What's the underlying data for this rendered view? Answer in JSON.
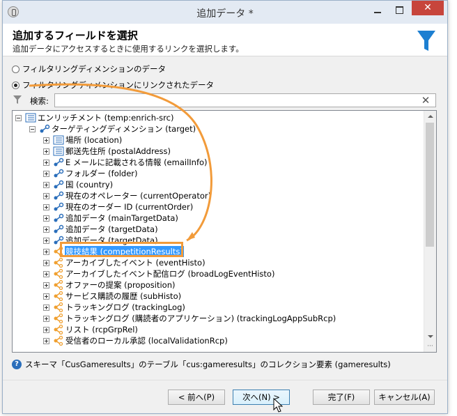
{
  "window": {
    "title": "追加データ *",
    "close_glyph": "✕",
    "app_icon": "app-icon"
  },
  "header": {
    "title": "追加するフィールドを選択",
    "subtitle": "追加データにアクセスするときに使用するリンクを選択します。",
    "icon": "funnel-icon",
    "accent": "#1d7fd1"
  },
  "options": {
    "radio1": {
      "label": "フィルタリングディメンションのデータ",
      "checked": false
    },
    "radio2": {
      "label": "フィルタリングディメンションにリンクされたデータ",
      "checked": true
    }
  },
  "search": {
    "label": "検索:",
    "value": "",
    "placeholder": "",
    "clear_glyph": "✕"
  },
  "tree": {
    "items": [
      {
        "label": "エンリッチメント (temp:enrich-src)",
        "level": 0,
        "expander": "minus",
        "icon": "table-icon"
      },
      {
        "label": "ターゲティングディメンション (target)",
        "level": 1,
        "expander": "minus",
        "icon": "link-icon"
      },
      {
        "label": "場所 (location)",
        "level": 2,
        "expander": "plus",
        "icon": "table-icon"
      },
      {
        "label": "郵送先住所 (postalAddress)",
        "level": 2,
        "expander": "plus",
        "icon": "table-icon"
      },
      {
        "label": "E メールに記載される情報 (emailInfo)",
        "level": 2,
        "expander": "plus",
        "icon": "link-icon"
      },
      {
        "label": "フォルダー (folder)",
        "level": 2,
        "expander": "plus",
        "icon": "link-icon"
      },
      {
        "label": "国 (country)",
        "level": 2,
        "expander": "plus",
        "icon": "link-icon"
      },
      {
        "label": "現在のオペレーター (currentOperator)",
        "level": 2,
        "expander": "plus",
        "icon": "link-icon"
      },
      {
        "label": "現在のオーダー ID (currentOrder)",
        "level": 2,
        "expander": "plus",
        "icon": "link-icon"
      },
      {
        "label": "追加データ (mainTargetData)",
        "level": 2,
        "expander": "plus",
        "icon": "link-icon"
      },
      {
        "label": "追加データ (targetData)",
        "level": 2,
        "expander": "plus",
        "icon": "link-icon"
      },
      {
        "label": "追加データ (targetData)",
        "level": 2,
        "expander": "plus",
        "icon": "link-icon"
      },
      {
        "label": "競技結果 (competitionResults)",
        "level": 2,
        "expander": "plus",
        "icon": "collection-icon",
        "selected": true
      },
      {
        "label": "アーカイブしたイベント (eventHisto)",
        "level": 2,
        "expander": "plus",
        "icon": "collection-icon"
      },
      {
        "label": "アーカイブしたイベント配信ログ (broadLogEventHisto)",
        "level": 2,
        "expander": "plus",
        "icon": "collection-icon"
      },
      {
        "label": "オファーの提案 (proposition)",
        "level": 2,
        "expander": "plus",
        "icon": "collection-icon"
      },
      {
        "label": "サービス購読の履歴 (subHisto)",
        "level": 2,
        "expander": "plus",
        "icon": "collection-icon"
      },
      {
        "label": "トラッキングログ (trackingLog)",
        "level": 2,
        "expander": "plus",
        "icon": "collection-icon"
      },
      {
        "label": "トラッキングログ (購読者のアプリケーション) (trackingLogAppSubRcp)",
        "level": 2,
        "expander": "plus",
        "icon": "collection-icon"
      },
      {
        "label": "リスト (rcpGrpRel)",
        "level": 2,
        "expander": "plus",
        "icon": "collection-icon"
      },
      {
        "label": "受信者のローカル承認 (localValidationRcp)",
        "level": 2,
        "expander": "plus",
        "icon": "collection-icon"
      }
    ],
    "scroll_grip": "···"
  },
  "info": {
    "icon": "help-icon",
    "glyph": "?",
    "text": "スキーマ「CusGameresults」のテーブル「cus:gameresults」のコレクション要素 (gameresults)"
  },
  "footer": {
    "prev_label": "< 前へ(P)",
    "next_label": "次へ(N) >",
    "finish_label": "完了(F)",
    "cancel_label": "キャンセル(A)"
  },
  "annotation": {
    "color": "#f29b3a"
  },
  "colors": {
    "link_icon": "#2a6ebb",
    "collection_icon": "#f0a030",
    "selection": "#3399ff"
  }
}
